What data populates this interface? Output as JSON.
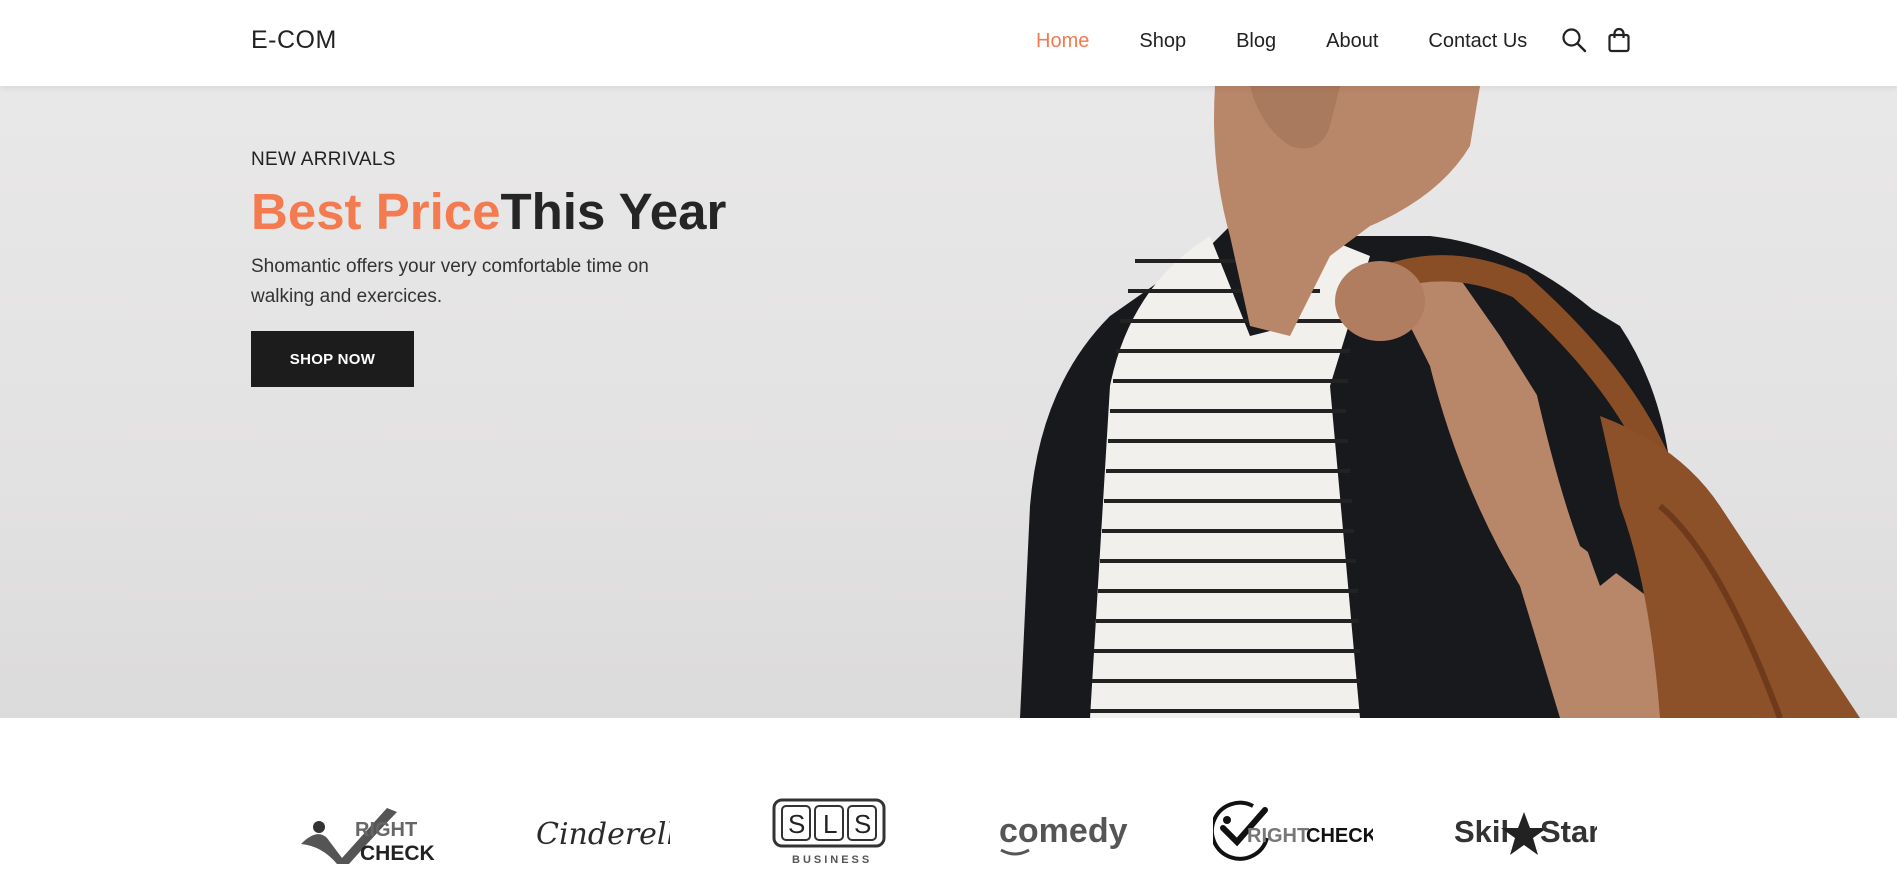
{
  "header": {
    "brand": "E-COM",
    "nav": [
      {
        "label": "Home",
        "active": true
      },
      {
        "label": "Shop",
        "active": false
      },
      {
        "label": "Blog",
        "active": false
      },
      {
        "label": "About",
        "active": false
      },
      {
        "label": "Contact Us",
        "active": false
      }
    ],
    "icons": [
      "search-icon",
      "shopping-bag-icon"
    ]
  },
  "hero": {
    "eyebrow": "NEW ARRIVALS",
    "headline_accent": "Best Price",
    "headline_rest": "This Year",
    "subtext": "Shomantic offers your very comfortable time on walking and exercices.",
    "cta_label": "SHOP NOW",
    "image": "man-with-leather-bag-photo"
  },
  "brands": {
    "logos": [
      {
        "name": "right-check-logo",
        "line1": "RIGHT",
        "line2": "CHECK"
      },
      {
        "name": "cinderella-logo",
        "text": "Cinderella"
      },
      {
        "name": "sls-business-logo",
        "letters": [
          "S",
          "L",
          "S"
        ],
        "sub": "BUSINESS"
      },
      {
        "name": "comedy-logo",
        "text": "comedy"
      },
      {
        "name": "rightcheck-circle-logo",
        "text1": "RIGHT",
        "text2": "CHECK"
      },
      {
        "name": "skillstar-logo",
        "text1": "Skil",
        "text2": "Star"
      }
    ]
  },
  "colors": {
    "accent": "#f47a50",
    "dark": "#1c1c1c",
    "hero_bg": "#e6e5e5"
  }
}
